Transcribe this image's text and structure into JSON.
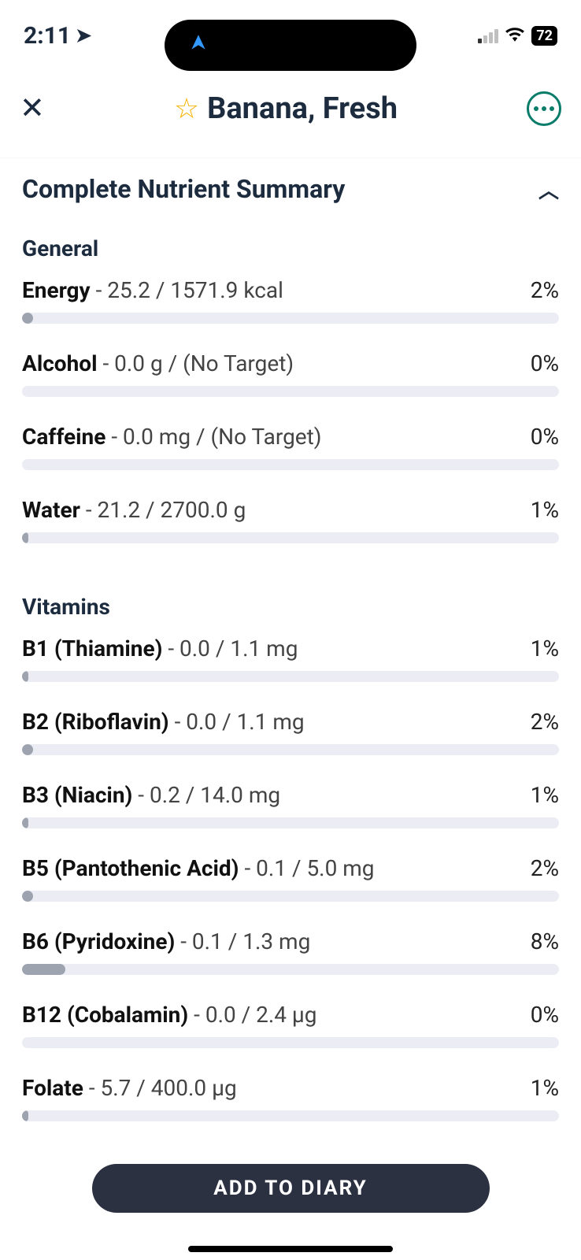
{
  "status": {
    "time": "2:11",
    "battery": "72"
  },
  "header": {
    "title": "Banana, Fresh"
  },
  "summary": {
    "title": "Complete Nutrient Summary"
  },
  "groups": [
    {
      "title": "General",
      "items": [
        {
          "name": "Energy",
          "vals": " - 25.2 / 1571.9 kcal",
          "pct": "2%",
          "fill": 2
        },
        {
          "name": "Alcohol",
          "vals": " - 0.0 g / (No Target)",
          "pct": "0%",
          "fill": 0
        },
        {
          "name": "Caffeine",
          "vals": " - 0.0 mg / (No Target)",
          "pct": "0%",
          "fill": 0
        },
        {
          "name": "Water",
          "vals": " - 21.2 / 2700.0 g",
          "pct": "1%",
          "fill": 1
        }
      ]
    },
    {
      "title": "Vitamins",
      "items": [
        {
          "name": "B1 (Thiamine)",
          "vals": " - 0.0 / 1.1 mg",
          "pct": "1%",
          "fill": 1
        },
        {
          "name": "B2 (Riboflavin)",
          "vals": " - 0.0 / 1.1 mg",
          "pct": "2%",
          "fill": 2
        },
        {
          "name": "B3 (Niacin)",
          "vals": " - 0.2 / 14.0 mg",
          "pct": "1%",
          "fill": 1
        },
        {
          "name": "B5 (Pantothenic Acid)",
          "vals": " - 0.1 / 5.0 mg",
          "pct": "2%",
          "fill": 2
        },
        {
          "name": "B6 (Pyridoxine)",
          "vals": " - 0.1 / 1.3 mg",
          "pct": "8%",
          "fill": 8
        },
        {
          "name": "B12 (Cobalamin)",
          "vals": " - 0.0 / 2.4 µg",
          "pct": "0%",
          "fill": 0
        },
        {
          "name": "Folate",
          "vals": " - 5.7 / 400.0 µg",
          "pct": "1%",
          "fill": 1
        }
      ]
    }
  ],
  "cta": {
    "label": "ADD TO DIARY"
  }
}
